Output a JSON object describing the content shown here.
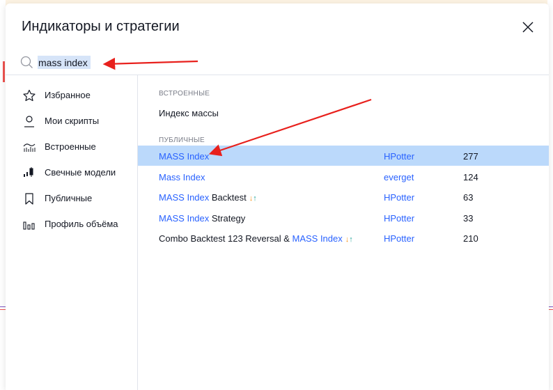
{
  "dialog": {
    "title": "Индикаторы и стратегии",
    "close_icon": "close-icon"
  },
  "search": {
    "value": "mass index",
    "icon": "search-icon"
  },
  "sidebar": {
    "items": [
      {
        "label": "Избранное",
        "icon": "star-icon"
      },
      {
        "label": "Мои скрипты",
        "icon": "user-icon"
      },
      {
        "label": "Встроенные",
        "icon": "builtin-chart-icon"
      },
      {
        "label": "Свечные модели",
        "icon": "candles-icon"
      },
      {
        "label": "Публичные",
        "icon": "bookmark-icon"
      },
      {
        "label": "Профиль объёма",
        "icon": "volume-profile-icon"
      }
    ]
  },
  "content": {
    "builtin_header": "ВСТРОЕННЫЕ",
    "builtin_items": [
      "Индекс массы"
    ],
    "public_header": "ПУБЛИЧНЫЕ",
    "public_items": [
      {
        "name_highlight": "MASS Index",
        "name_rest": "",
        "author": "HPotter",
        "likes": "277",
        "selected": true,
        "strategy_arrows": false
      },
      {
        "name_highlight": "Mass Index",
        "name_rest": "",
        "author": "everget",
        "likes": "124",
        "selected": false,
        "strategy_arrows": false
      },
      {
        "name_highlight": "MASS Index",
        "name_rest": " Backtest",
        "author": "HPotter",
        "likes": "63",
        "selected": false,
        "strategy_arrows": true
      },
      {
        "name_highlight": "MASS Index",
        "name_rest": " Strategy",
        "author": "HPotter",
        "likes": "33",
        "selected": false,
        "strategy_arrows": false
      },
      {
        "name_prefix": "Combo Backtest 123 Reversal & ",
        "name_highlight": "MASS Index",
        "name_rest": "",
        "author": "HPotter",
        "likes": "210",
        "selected": false,
        "strategy_arrows": true
      }
    ],
    "strategy_arrow_glyphs": {
      "down": "↓",
      "up": "↑"
    }
  },
  "colors": {
    "accent": "#2962ff",
    "selected_row": "#bbd9fb",
    "annotation_arrow": "#e8201c",
    "background": "#fdf3e3"
  }
}
